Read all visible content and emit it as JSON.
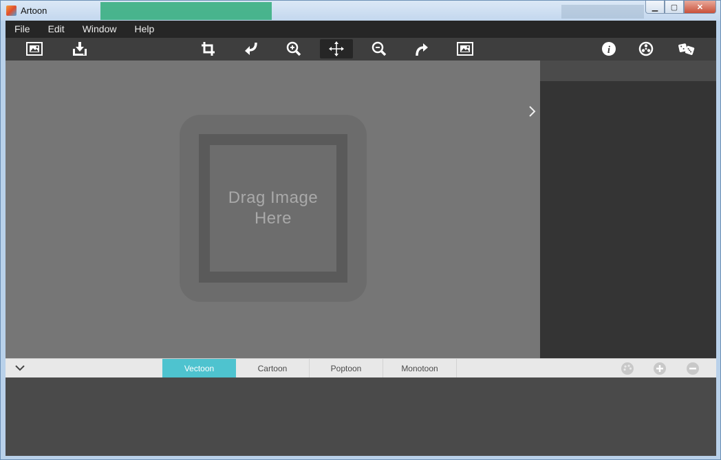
{
  "window": {
    "title": "Artoon"
  },
  "menu": [
    "File",
    "Edit",
    "Window",
    "Help"
  ],
  "toolbar": {
    "left": [
      "open-image-icon",
      "save-icon"
    ],
    "center": [
      "crop-icon",
      "undo-icon",
      "zoom-in-icon",
      "move-icon",
      "zoom-out-icon",
      "redo-icon",
      "fit-image-icon"
    ],
    "right": [
      "info-icon",
      "settings-icon",
      "random-dice-icon"
    ],
    "active": "move-icon"
  },
  "canvas": {
    "drop_text": "Drag Image\nHere"
  },
  "styles": {
    "tabs": [
      "Vectoon",
      "Cartoon",
      "Poptoon",
      "Monotoon"
    ],
    "active_tab": "Vectoon",
    "accent_color": "#4ec3cf"
  }
}
